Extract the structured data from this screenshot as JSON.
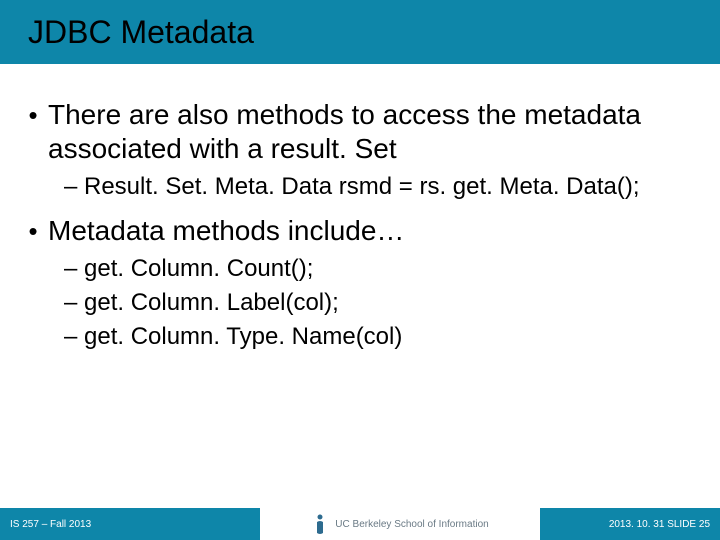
{
  "header": {
    "title": "JDBC Metadata"
  },
  "content": {
    "bullet1": "There are also methods to access the metadata associated with a result. Set",
    "sub1": "Result. Set. Meta. Data rsmd = rs. get. Meta. Data();",
    "bullet2": "Metadata methods include…",
    "sub2a": "get. Column. Count();",
    "sub2b": "get. Column. Label(col);",
    "sub2c": "get. Column. Type. Name(col)"
  },
  "footer": {
    "left": "IS 257 – Fall 2013",
    "mid": "UC Berkeley School of Information",
    "right": "2013. 10. 31 SLIDE 25"
  }
}
